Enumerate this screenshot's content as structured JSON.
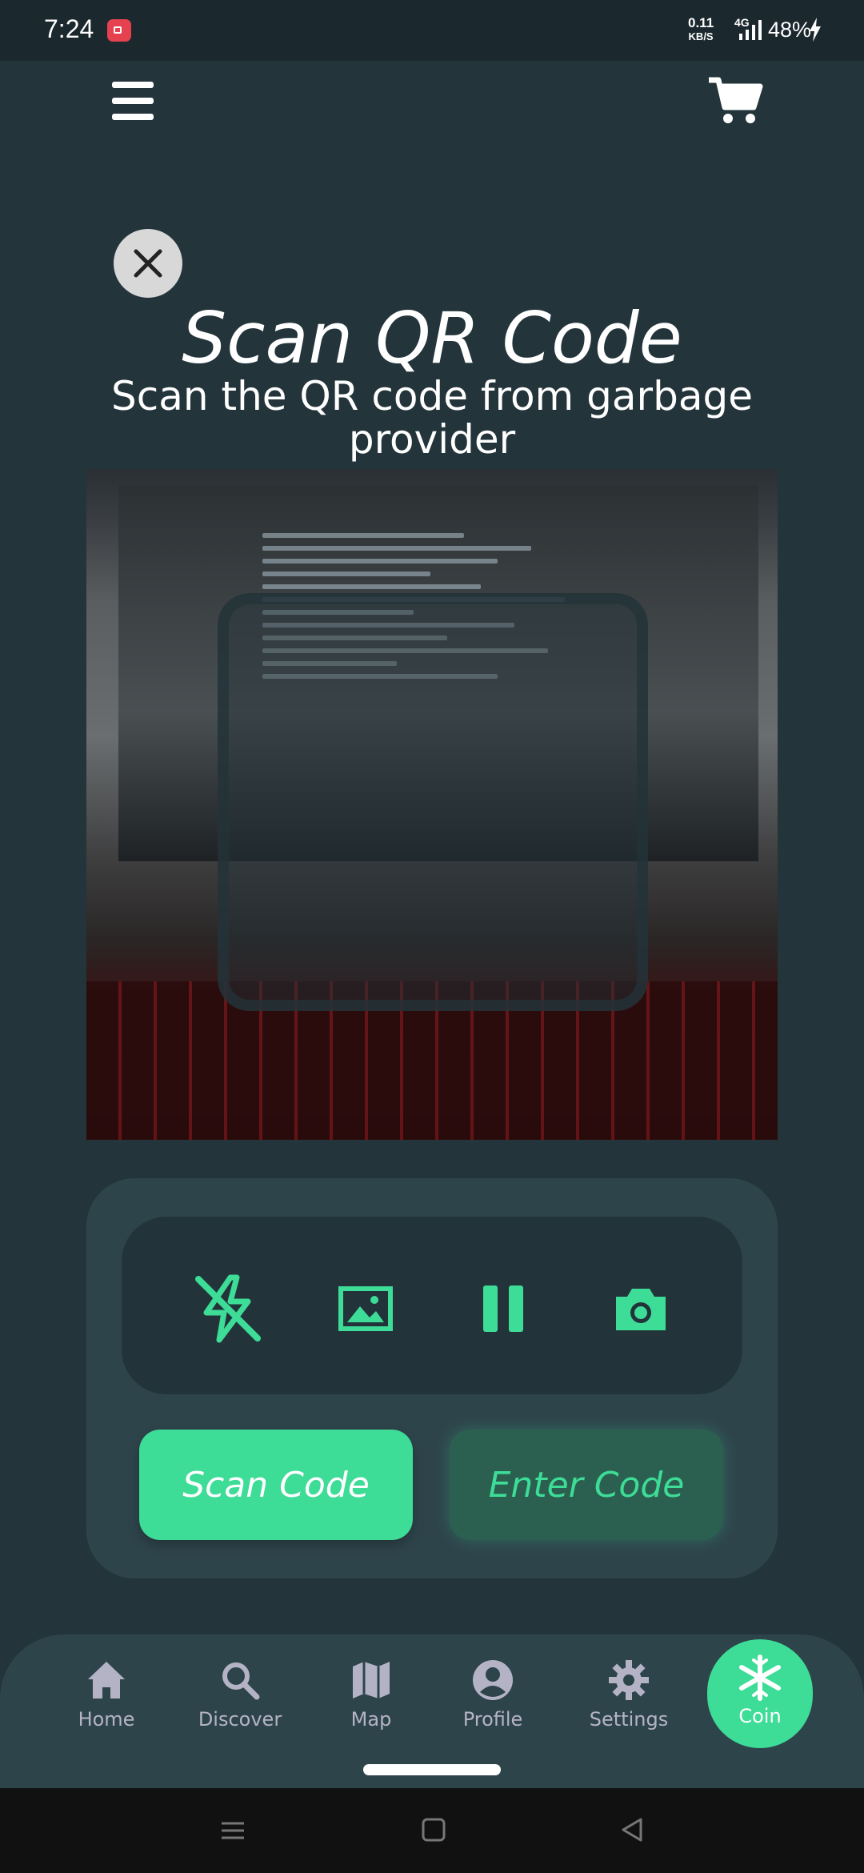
{
  "status_bar": {
    "time": "7:24",
    "net_speed_value": "0.11",
    "net_speed_unit": "KB/S",
    "network_type": "4G",
    "battery": "48%"
  },
  "header": {
    "menu_icon": "hamburger-menu-icon",
    "cart_icon": "shopping-cart-icon"
  },
  "scanner": {
    "title": "Scan QR Code",
    "subtitle": "Scan the QR code from garbage provider",
    "close_icon": "close-icon"
  },
  "controls": {
    "icons": [
      "flash-off-icon",
      "gallery-icon",
      "pause-icon",
      "camera-icon"
    ],
    "scan_button": "Scan Code",
    "enter_button": "Enter Code"
  },
  "bottom_nav": {
    "items": [
      {
        "label": "Home",
        "icon": "home-icon"
      },
      {
        "label": "Discover",
        "icon": "search-icon"
      },
      {
        "label": "Map",
        "icon": "map-icon"
      },
      {
        "label": "Profile",
        "icon": "profile-icon"
      },
      {
        "label": "Settings",
        "icon": "settings-icon"
      },
      {
        "label": "Coin",
        "icon": "snowflake-icon"
      }
    ],
    "active": "Coin"
  },
  "colors": {
    "background": "#23343a",
    "panel": "#2e444b",
    "accent": "#3ddc97",
    "nav_inactive": "#b4b3c6"
  }
}
